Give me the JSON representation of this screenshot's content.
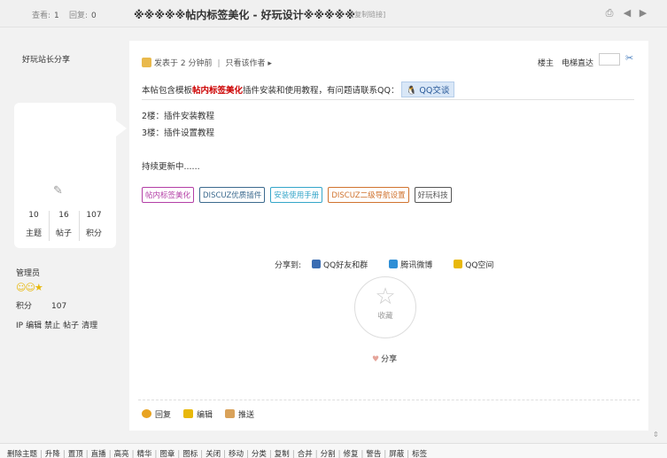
{
  "topbar": {
    "views_label": "查看:",
    "views_value": "1",
    "replies_label": "回复:",
    "replies_value": "0",
    "title": "※※※※※帖内标签美化 - 好玩设计※※※※※",
    "copy_link": "[复制链接]"
  },
  "author": {
    "name": "好玩站长分享",
    "stats": [
      {
        "value": "10",
        "label": "主题"
      },
      {
        "value": "16",
        "label": "帖子"
      },
      {
        "value": "107",
        "label": "积分"
      }
    ],
    "group": "管理员",
    "points_label": "积分",
    "points_value": "107",
    "admin_links": [
      "IP",
      "编辑",
      "禁止",
      "帖子",
      "清理"
    ]
  },
  "post": {
    "meta_prefix": "发表于",
    "meta_time": "2 分钟前",
    "meta_sep": "|",
    "only_author": "只看该作者",
    "floor": "楼主",
    "jump_label": "电梯直达",
    "intro_pre": "本帖包含模板",
    "intro_hl": "帖内标签美化",
    "intro_post": "插件安装和使用教程，有问题请联系QQ：",
    "qq_btn": "QQ交谈",
    "lines": [
      "2楼：插件安装教程",
      "3楼：插件设置教程",
      "持续更新中......"
    ],
    "tags": [
      {
        "text": "帖内标签美化",
        "color": "#b33fa6"
      },
      {
        "text": "DISCUZ优质插件",
        "color": "#3c6a8e"
      },
      {
        "text": "安装使用手册",
        "color": "#35a6c9"
      },
      {
        "text": "DISCUZ二级导航设置",
        "color": "#d0732f"
      },
      {
        "text": "好玩科技",
        "color": "#555555"
      }
    ],
    "share_label": "分享到:",
    "share_items": [
      {
        "text": "QQ好友和群",
        "color": "#3a6db3"
      },
      {
        "text": "腾讯微博",
        "color": "#2f8fd6"
      },
      {
        "text": "QQ空间",
        "color": "#e8b80a"
      }
    ],
    "fav_label": "收藏",
    "share_btn": "分享",
    "actions": [
      "回复",
      "编辑",
      "推送"
    ]
  },
  "bottombar": {
    "items": [
      "删除主题",
      "升降",
      "置顶",
      "直播",
      "高亮",
      "精华",
      "图章",
      "图标",
      "关闭",
      "移动",
      "分类",
      "复制",
      "合并",
      "分割",
      "修复",
      "警告",
      "屏蔽",
      "标签"
    ]
  }
}
